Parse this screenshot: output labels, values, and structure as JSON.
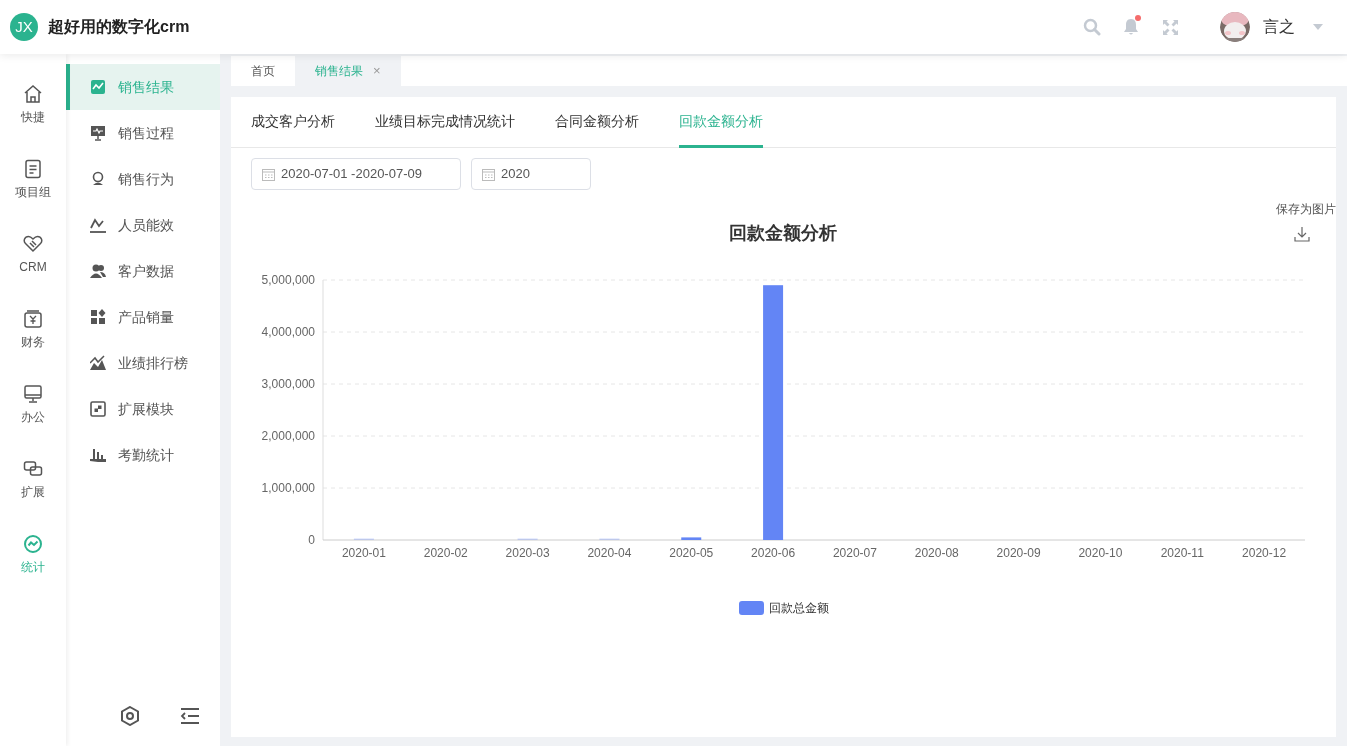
{
  "header": {
    "logo": "JX",
    "title": "超好用的数字化crm",
    "notification_dot": true,
    "user_name": "言之"
  },
  "rail": [
    {
      "label": "快捷",
      "selected": false
    },
    {
      "label": "项目组",
      "selected": false
    },
    {
      "label": "CRM",
      "selected": false
    },
    {
      "label": "财务",
      "selected": false
    },
    {
      "label": "办公",
      "selected": false
    },
    {
      "label": "扩展",
      "selected": false
    },
    {
      "label": "统计",
      "selected": true
    }
  ],
  "menu": [
    {
      "label": "销售结果",
      "selected": true
    },
    {
      "label": "销售过程",
      "selected": false
    },
    {
      "label": "销售行为",
      "selected": false
    },
    {
      "label": "人员能效",
      "selected": false
    },
    {
      "label": "客户数据",
      "selected": false
    },
    {
      "label": "产品销量",
      "selected": false
    },
    {
      "label": "业绩排行榜",
      "selected": false
    },
    {
      "label": "扩展模块",
      "selected": false
    },
    {
      "label": "考勤统计",
      "selected": false
    }
  ],
  "tabs": [
    {
      "label": "首页",
      "selected": false
    },
    {
      "label": "销售结果",
      "selected": true,
      "close": "×"
    }
  ],
  "report_tabs": [
    {
      "label": "成交客户分析",
      "selected": false
    },
    {
      "label": "业绩目标完成情况统计",
      "selected": false
    },
    {
      "label": "合同金额分析",
      "selected": false
    },
    {
      "label": "回款金额分析",
      "selected": true
    }
  ],
  "filters": [
    {
      "value": "2020-07-01 -2020-07-09"
    },
    {
      "value": "2020"
    }
  ],
  "chart": {
    "save_label": "保存为图片",
    "chart_data": {
      "type": "bar",
      "title": "回款金额分析",
      "categories": [
        "2020-01",
        "2020-02",
        "2020-03",
        "2020-04",
        "2020-05",
        "2020-06",
        "2020-07",
        "2020-08",
        "2020-09",
        "2020-10",
        "2020-11",
        "2020-12"
      ],
      "series": [
        {
          "name": "回款总金额",
          "color": "#6385f5",
          "values": [
            10000,
            0,
            10000,
            10000,
            50000,
            4900000,
            0,
            0,
            0,
            0,
            0,
            0
          ]
        }
      ],
      "grid": true,
      "ylim": [
        0,
        5000000
      ],
      "yticks": [
        {
          "value": 0,
          "label": "0"
        },
        {
          "value": 1000000,
          "label": "1,000,000"
        },
        {
          "value": 2000000,
          "label": "2,000,000"
        },
        {
          "value": 3000000,
          "label": "3,000,000"
        },
        {
          "value": 4000000,
          "label": "4,000,000"
        },
        {
          "value": 5000000,
          "label": "5,000,000"
        }
      ]
    }
  }
}
